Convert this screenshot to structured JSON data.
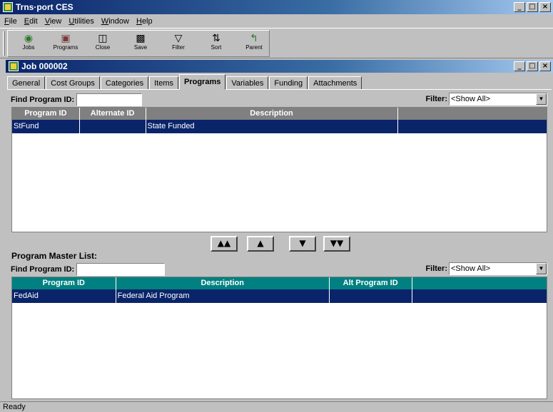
{
  "app": {
    "title": "Trns·port CES",
    "window_buttons": [
      "_",
      "□",
      "×"
    ]
  },
  "menu": [
    "File",
    "Edit",
    "View",
    "Utilities",
    "Window",
    "Help"
  ],
  "toolbar": [
    {
      "label": "Jobs",
      "icon": "jobs-icon"
    },
    {
      "label": "Programs",
      "icon": "programs-icon"
    },
    {
      "label": "Close",
      "icon": "close-door-icon"
    },
    {
      "label": "Save",
      "icon": "save-icon"
    },
    {
      "label": "Filter",
      "icon": "filter-icon"
    },
    {
      "label": "Sort",
      "icon": "sort-icon"
    },
    {
      "label": "Parent",
      "icon": "parent-icon"
    }
  ],
  "child": {
    "title": "Job 000002"
  },
  "tabs": [
    "General",
    "Cost Groups",
    "Categories",
    "Items",
    "Programs",
    "Variables",
    "Funding",
    "Attachments"
  ],
  "active_tab": "Programs",
  "programs": {
    "find_label": "Find Program ID:",
    "find_value": "",
    "filter_label": "Filter:",
    "filter_value": "<Show All>",
    "columns": [
      "Program ID",
      "Alternate ID",
      "Description"
    ],
    "rows": [
      {
        "program_id": "StFund",
        "alternate_id": "",
        "description": "State Funded"
      }
    ],
    "header_color": "#808080"
  },
  "nav_buttons": [
    "move-all-up",
    "move-up",
    "move-down",
    "move-all-down"
  ],
  "master": {
    "title": "Program Master List:",
    "find_label": "Find Program ID:",
    "find_value": "",
    "filter_label": "Filter:",
    "filter_value": "<Show All>",
    "columns": [
      "Program ID",
      "Description",
      "Alt Program ID"
    ],
    "rows": [
      {
        "program_id": "FedAid",
        "description": "Federal Aid Program",
        "alt_program_id": ""
      }
    ],
    "header_color": "#008080"
  },
  "status": "Ready",
  "colors": {
    "titlebar": "#0a246a",
    "selection": "#0a246a",
    "face": "#c0c0c0"
  }
}
